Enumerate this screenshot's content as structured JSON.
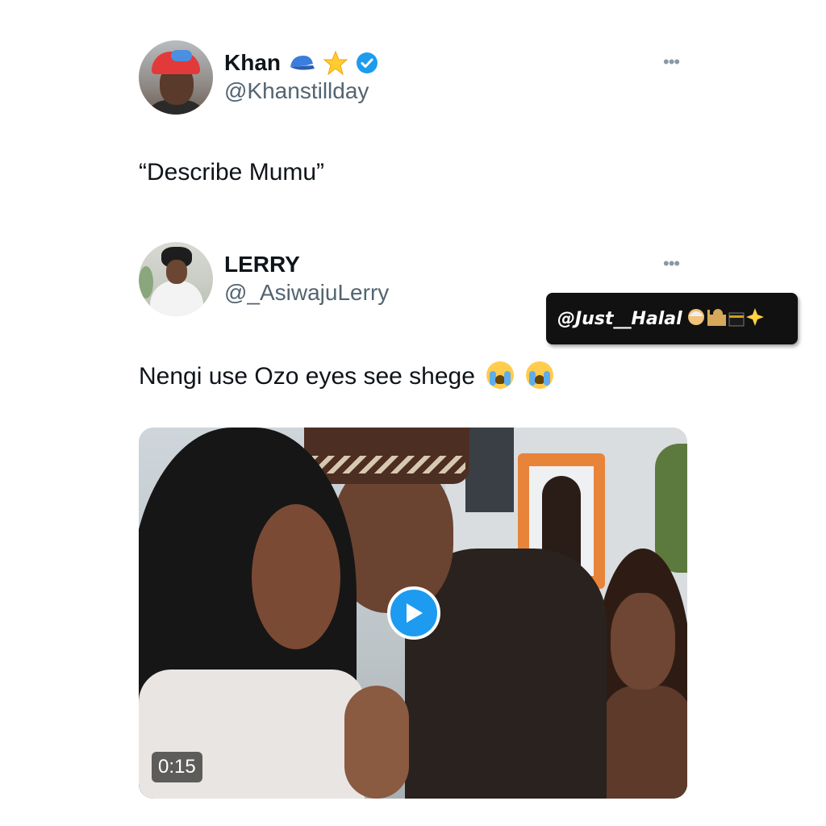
{
  "quoted_tweet": {
    "display_name": "Khan",
    "badges": [
      "blue-cap-icon",
      "glowing-star-icon",
      "verified-badge-icon"
    ],
    "handle": "@Khanstillday",
    "text": "“Describe Mumu”",
    "more_label": "•••"
  },
  "reply_tweet": {
    "display_name": "LERRY",
    "handle": "@_AsiwajuLerry",
    "text": "Nengi use Ozo eyes see shege",
    "emojis": [
      "loudly-crying-face-icon",
      "loudly-crying-face-icon"
    ],
    "more_label": "•••"
  },
  "watermark": {
    "text": "@Just__Halal",
    "decor_icons": [
      "person-icon",
      "mosque-icon",
      "kaaba-icon",
      "sparkles-icon"
    ]
  },
  "video": {
    "duration": "0:15",
    "play_icon": "play-icon"
  },
  "colors": {
    "verified": "#1d9bf0",
    "play_button": "#1d9bf0",
    "handle": "#536471"
  }
}
